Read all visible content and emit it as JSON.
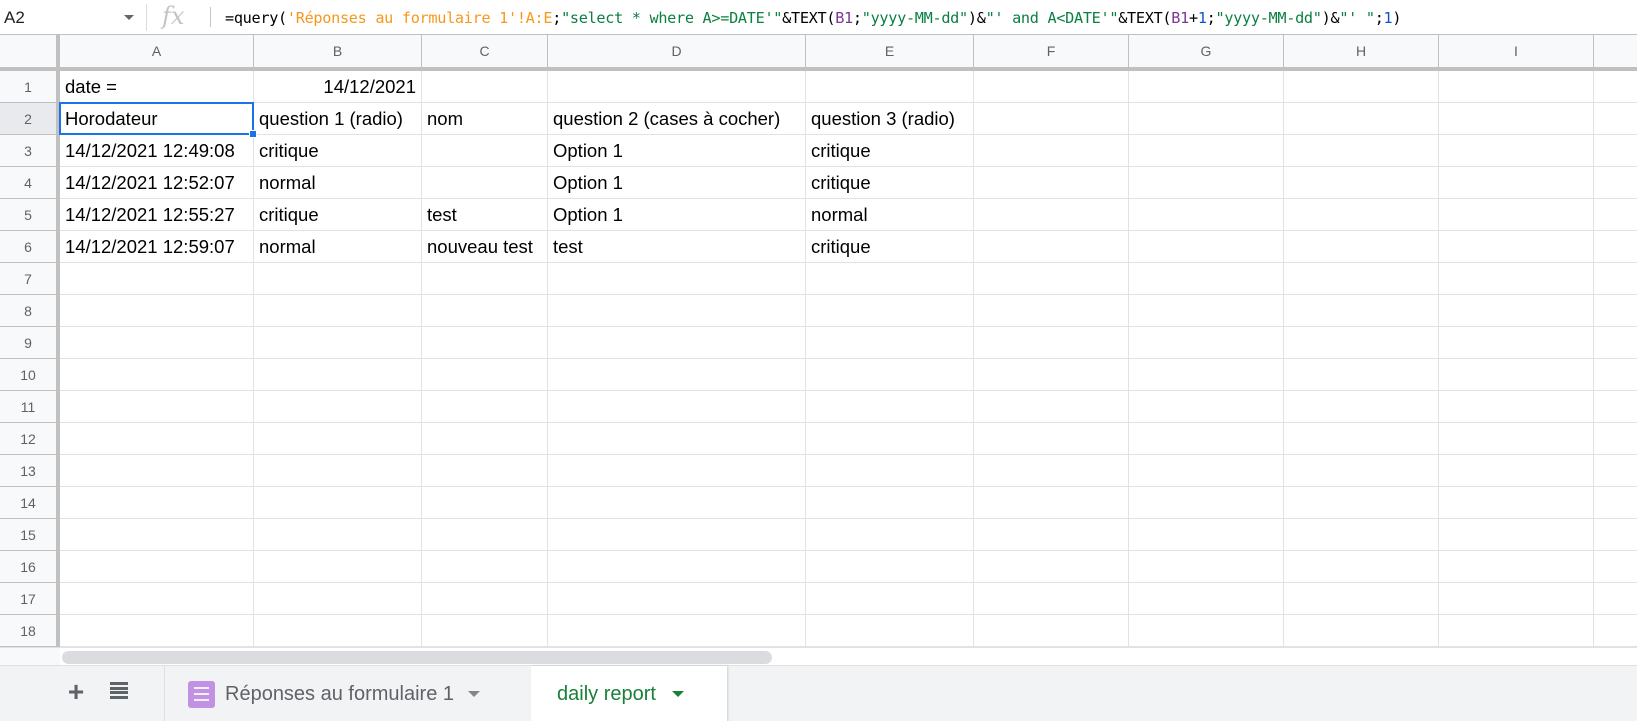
{
  "formula_bar": {
    "name_box": "A2",
    "fx_label": "fx",
    "formula_tokens": [
      {
        "t": "=query(",
        "k": "plain"
      },
      {
        "t": "'Réponses au formulaire 1'!A:E",
        "k": "sheet"
      },
      {
        "t": ";",
        "k": "plain"
      },
      {
        "t": "\"select * where A>=DATE'\"",
        "k": "str"
      },
      {
        "t": "&TEXT(",
        "k": "plain"
      },
      {
        "t": "B1",
        "k": "ref"
      },
      {
        "t": ";",
        "k": "plain"
      },
      {
        "t": "\"yyyy-MM-dd\"",
        "k": "str"
      },
      {
        "t": ")&",
        "k": "plain"
      },
      {
        "t": "\"' and A<DATE'\"",
        "k": "str"
      },
      {
        "t": "&TEXT(",
        "k": "plain"
      },
      {
        "t": "B1",
        "k": "ref"
      },
      {
        "t": "+",
        "k": "plain"
      },
      {
        "t": "1",
        "k": "num"
      },
      {
        "t": ";",
        "k": "plain"
      },
      {
        "t": "\"yyyy-MM-dd\"",
        "k": "str"
      },
      {
        "t": ")&",
        "k": "plain"
      },
      {
        "t": "\"' \"",
        "k": "str"
      },
      {
        "t": ";",
        "k": "plain"
      },
      {
        "t": "1",
        "k": "num"
      },
      {
        "t": ")",
        "k": "plain"
      }
    ]
  },
  "grid": {
    "columns": [
      "A",
      "B",
      "C",
      "D",
      "E",
      "F",
      "G",
      "H",
      "I",
      ""
    ],
    "rows": [
      "1",
      "2",
      "3",
      "4",
      "5",
      "6",
      "7",
      "8",
      "9",
      "10",
      "11",
      "12",
      "13",
      "14",
      "15",
      "16",
      "17",
      "18"
    ],
    "selected_cell": "A2",
    "cells": [
      [
        "date =",
        "14/12/2021",
        "",
        "",
        ""
      ],
      [
        "Horodateur",
        "question 1 (radio)",
        "nom",
        "question 2 (cases à cocher)",
        "question 3 (radio)"
      ],
      [
        "14/12/2021 12:49:08",
        "critique",
        "",
        "Option 1",
        "critique"
      ],
      [
        "14/12/2021 12:52:07",
        "normal",
        "",
        "Option 1",
        "critique"
      ],
      [
        "14/12/2021 12:55:27",
        "critique",
        "test",
        "Option 1",
        "normal"
      ],
      [
        "14/12/2021 12:59:07",
        "normal",
        "nouveau test",
        "test",
        "critique"
      ]
    ],
    "right_aligned": [
      "B1"
    ]
  },
  "sheet_tabs": {
    "add_label": "+",
    "tabs": [
      {
        "label": "Réponses au formulaire 1",
        "icon": "google-forms-icon",
        "active": false
      },
      {
        "label": "daily report",
        "active": true
      }
    ]
  },
  "colors": {
    "selection": "#1a73e8",
    "active_tab_text": "#188038",
    "form_icon": "#c191e4"
  }
}
